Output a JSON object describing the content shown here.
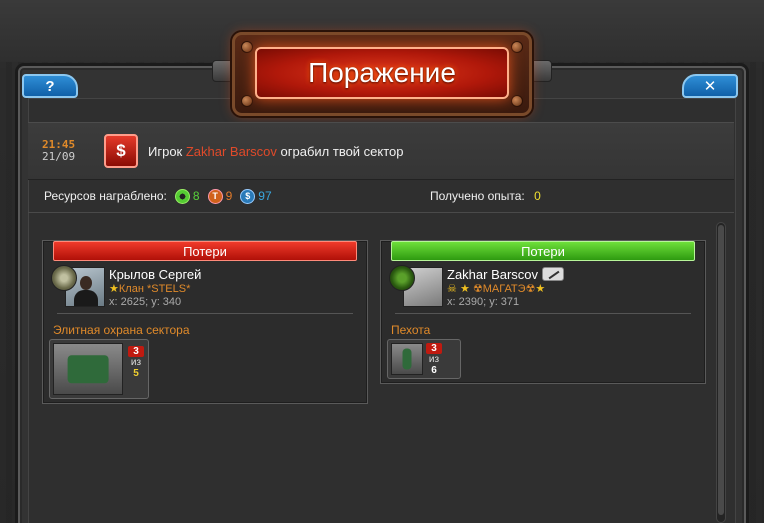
{
  "dialog": {
    "title": "Поражение",
    "help_label": "?",
    "close_label": "✕"
  },
  "event": {
    "time": "21:45",
    "date": "21/09",
    "icon": "robbery-dollar-icon",
    "msg_prefix": "Игрок",
    "player": "Zakhar Barscov",
    "msg_suffix": "ограбил твой сектор"
  },
  "resources": {
    "label": "Ресурсов награблено:",
    "items": [
      {
        "icon": "radiation-icon",
        "value": "8",
        "color": "#58d23a"
      },
      {
        "icon": "titanium-icon",
        "value": "9",
        "color": "#e07a2a"
      },
      {
        "icon": "credits-icon",
        "value": "97",
        "color": "#3aa8e0"
      }
    ],
    "exp_label": "Получено опыта:",
    "exp_value": "0"
  },
  "losses": {
    "left": {
      "header": "Потери",
      "header_color": "#d8200f",
      "player_name": "Крылов Сергей",
      "clan": "Клан *STELS*",
      "coords": "x: 2625; y: 340",
      "section": "Элитная охрана сектора",
      "unit": {
        "lost": "3",
        "of": "из",
        "total": "5"
      }
    },
    "right": {
      "header": "Потери",
      "header_color": "#4cc020",
      "player_name": "Zakhar Barscov",
      "clan": "☢МАГАТЭ☢",
      "coords": "x: 2390; y: 371",
      "section": "Пехота",
      "unit": {
        "lost": "3",
        "of": "из",
        "total": "6"
      }
    }
  }
}
